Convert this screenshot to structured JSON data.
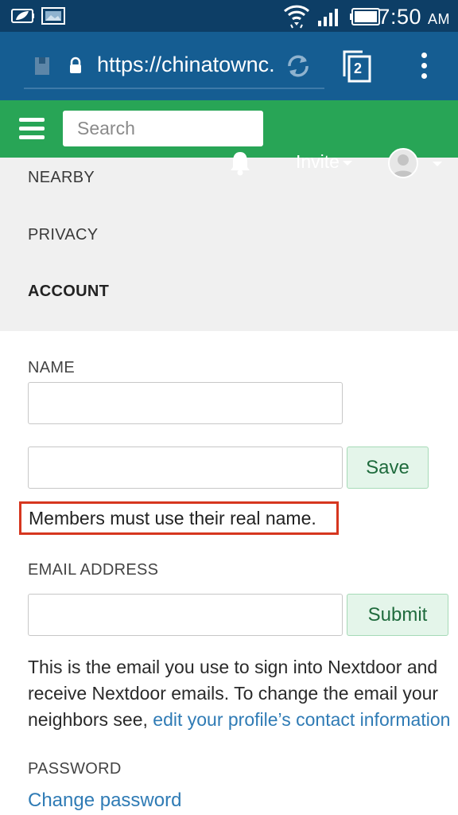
{
  "status_bar": {
    "time": "7:50",
    "ampm": "AM",
    "icons": [
      "leaf-battery-icon",
      "image-notification-icon",
      "wifi-icon",
      "signal-icon",
      "battery-icon"
    ]
  },
  "browser": {
    "url": "https://chinatownc...",
    "tab_count": "2",
    "icons": [
      "page-icon",
      "lock-icon",
      "reload-icon",
      "tabs-icon",
      "overflow-menu-icon"
    ]
  },
  "header": {
    "search_placeholder": "Search",
    "invite_label": "Invite",
    "colors": {
      "header_green": "#28a556",
      "browser_blue": "#155d92",
      "statusbar_blue": "#0d3e66"
    }
  },
  "nav": {
    "items": [
      {
        "label": "NEARBY"
      },
      {
        "label": "PRIVACY"
      },
      {
        "label": "ACCOUNT",
        "active": true
      }
    ]
  },
  "form": {
    "name_label": "NAME",
    "first_name_value": "",
    "last_name_value": "",
    "save_label": "Save",
    "notice": "Members must use their real name.",
    "email_label": "EMAIL ADDRESS",
    "email_value": "",
    "submit_label": "Submit",
    "help_line1": "This is the email you use to sign into Nextdoor and",
    "help_line2": "receive Nextdoor emails. To change the email your",
    "help_line3_prefix": "neighbors see, ",
    "help_link": "edit your profile’s contact information",
    "password_label": "PASSWORD",
    "change_password_link": "Change password"
  }
}
